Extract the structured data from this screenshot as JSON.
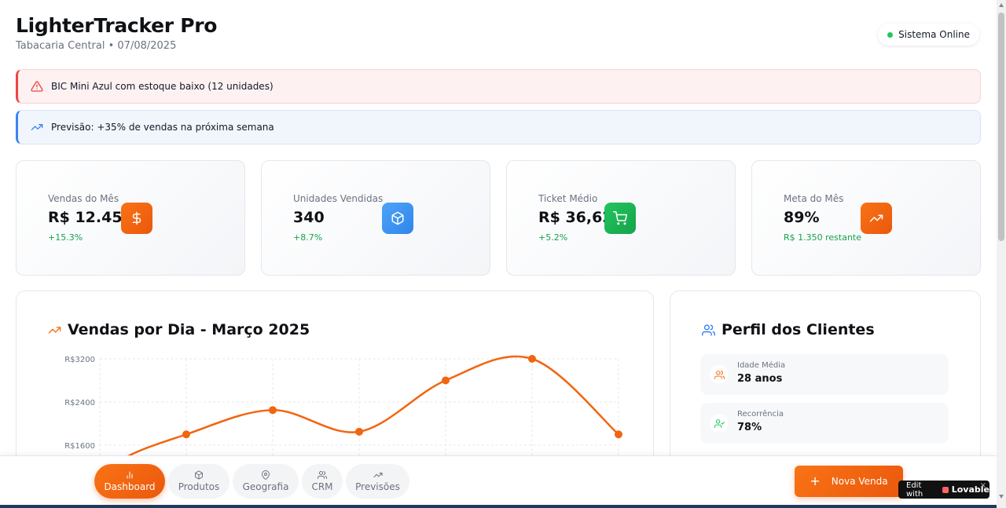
{
  "header": {
    "title": "LighterTracker Pro",
    "subtitle": "Tabacaria Central • 07/08/2025",
    "status": "Sistema Online"
  },
  "alerts": [
    {
      "type": "warning",
      "icon": "alert-triangle-icon",
      "text": "BIC Mini Azul com estoque baixo (12 unidades)",
      "color": "#ef4444"
    },
    {
      "type": "info",
      "icon": "trending-up-icon",
      "text": "Previsão: +35% de vendas na próxima semana",
      "color": "#3b82f6"
    }
  ],
  "stats": [
    {
      "label": "Vendas do Mês",
      "value": "R$ 12.450",
      "sub": "+15.3%",
      "icon": "dollar-icon",
      "color": "#f97316"
    },
    {
      "label": "Unidades Vendidas",
      "value": "340",
      "sub": "+8.7%",
      "icon": "package-icon",
      "color": "#3b82f6"
    },
    {
      "label": "Ticket Médio",
      "value": "R$ 36,62",
      "sub": "+5.2%",
      "icon": "cart-icon",
      "color": "#22c55e"
    },
    {
      "label": "Meta do Mês",
      "value": "89%",
      "sub": "R$ 1.350 restante",
      "icon": "trending-up-icon",
      "color": "#f97316"
    }
  ],
  "sales_chart": {
    "title": "Vendas por Dia - Março 2025",
    "icon": "trending-up-icon"
  },
  "chart_data": {
    "type": "line",
    "title": "Vendas por Dia - Março 2025",
    "xlabel": "",
    "ylabel": "",
    "y_ticks": [
      "R$3200",
      "R$2400",
      "R$1600"
    ],
    "ylim": [
      0,
      3200
    ],
    "series": [
      {
        "values": [
          1250,
          1800,
          2250,
          1850,
          2800,
          3200,
          1800
        ]
      }
    ],
    "line_color": "#f2650f",
    "grid": true
  },
  "profile": {
    "title": "Perfil dos Clientes",
    "items": [
      {
        "label": "Idade Média",
        "value": "28 anos",
        "icon": "users-icon",
        "color": "#f97316"
      },
      {
        "label": "Recorrência",
        "value": "78%",
        "icon": "user-check-icon",
        "color": "#22c55e"
      }
    ]
  },
  "nav": [
    {
      "label": "Dashboard",
      "icon": "bar-chart-icon",
      "active": true
    },
    {
      "label": "Produtos",
      "icon": "package-icon",
      "active": false
    },
    {
      "label": "Geografia",
      "icon": "map-pin-icon",
      "active": false
    },
    {
      "label": "CRM",
      "icon": "users-icon",
      "active": false
    },
    {
      "label": "Previsões",
      "icon": "trending-up-icon",
      "active": false
    }
  ],
  "cta": {
    "label": "Nova Venda",
    "icon": "plus-icon"
  },
  "badge": {
    "prefix": "Edit with",
    "brand": "Lovable",
    "close": "×"
  }
}
